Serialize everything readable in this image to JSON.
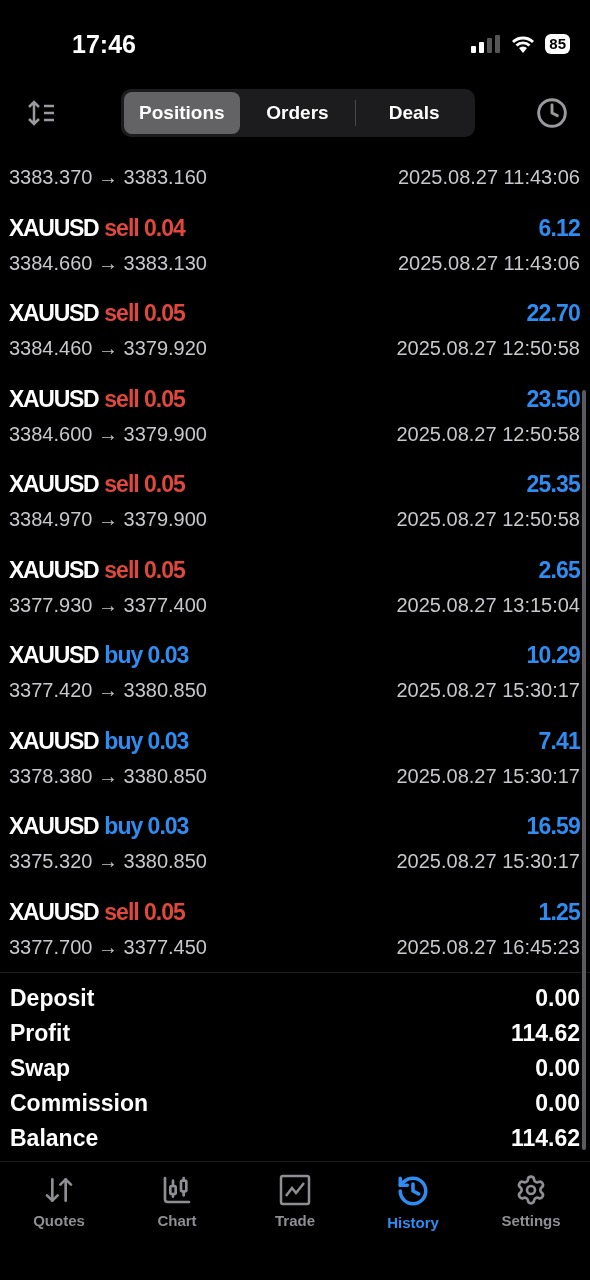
{
  "status_bar": {
    "time": "17:46",
    "battery": "85"
  },
  "segments": [
    {
      "label": "Positions",
      "selected": true
    },
    {
      "label": "Orders",
      "selected": false
    },
    {
      "label": "Deals",
      "selected": false
    }
  ],
  "partial_row": {
    "prices": "3383.370 → 3383.160",
    "time": "2025.08.27 11:43:06"
  },
  "deals": [
    {
      "symbol": "XAUUSD",
      "type": "sell",
      "volume": "0.04",
      "color": "#e0483e",
      "profit": "6.12",
      "prices": "3384.660 → 3383.130",
      "time": "2025.08.27 11:43:06"
    },
    {
      "symbol": "XAUUSD",
      "type": "sell",
      "volume": "0.05",
      "color": "#e0483e",
      "profit": "22.70",
      "prices": "3384.460 → 3379.920",
      "time": "2025.08.27 12:50:58"
    },
    {
      "symbol": "XAUUSD",
      "type": "sell",
      "volume": "0.05",
      "color": "#e0483e",
      "profit": "23.50",
      "prices": "3384.600 → 3379.900",
      "time": "2025.08.27 12:50:58"
    },
    {
      "symbol": "XAUUSD",
      "type": "sell",
      "volume": "0.05",
      "color": "#e0483e",
      "profit": "25.35",
      "prices": "3384.970 → 3379.900",
      "time": "2025.08.27 12:50:58"
    },
    {
      "symbol": "XAUUSD",
      "type": "sell",
      "volume": "0.05",
      "color": "#e0483e",
      "profit": "2.65",
      "prices": "3377.930 → 3377.400",
      "time": "2025.08.27 13:15:04"
    },
    {
      "symbol": "XAUUSD",
      "type": "buy",
      "volume": "0.03",
      "color": "#2f8cf0",
      "profit": "10.29",
      "prices": "3377.420 → 3380.850",
      "time": "2025.08.27 15:30:17"
    },
    {
      "symbol": "XAUUSD",
      "type": "buy",
      "volume": "0.03",
      "color": "#2f8cf0",
      "profit": "7.41",
      "prices": "3378.380 → 3380.850",
      "time": "2025.08.27 15:30:17"
    },
    {
      "symbol": "XAUUSD",
      "type": "buy",
      "volume": "0.03",
      "color": "#2f8cf0",
      "profit": "16.59",
      "prices": "3375.320 → 3380.850",
      "time": "2025.08.27 15:30:17"
    },
    {
      "symbol": "XAUUSD",
      "type": "sell",
      "volume": "0.05",
      "color": "#e0483e",
      "profit": "1.25",
      "prices": "3377.700 → 3377.450",
      "time": "2025.08.27 16:45:23"
    }
  ],
  "summary": [
    {
      "label": "Deposit",
      "value": "0.00"
    },
    {
      "label": "Profit",
      "value": "114.62"
    },
    {
      "label": "Swap",
      "value": "0.00"
    },
    {
      "label": "Commission",
      "value": "0.00"
    },
    {
      "label": "Balance",
      "value": "114.62"
    }
  ],
  "tab_bar": [
    {
      "kind": "quotes",
      "label": "Quotes",
      "selected": false
    },
    {
      "kind": "chart",
      "label": "Chart",
      "selected": false
    },
    {
      "kind": "trade",
      "label": "Trade",
      "selected": false
    },
    {
      "kind": "history",
      "label": "History",
      "selected": true
    },
    {
      "kind": "settings",
      "label": "Settings",
      "selected": false
    }
  ]
}
